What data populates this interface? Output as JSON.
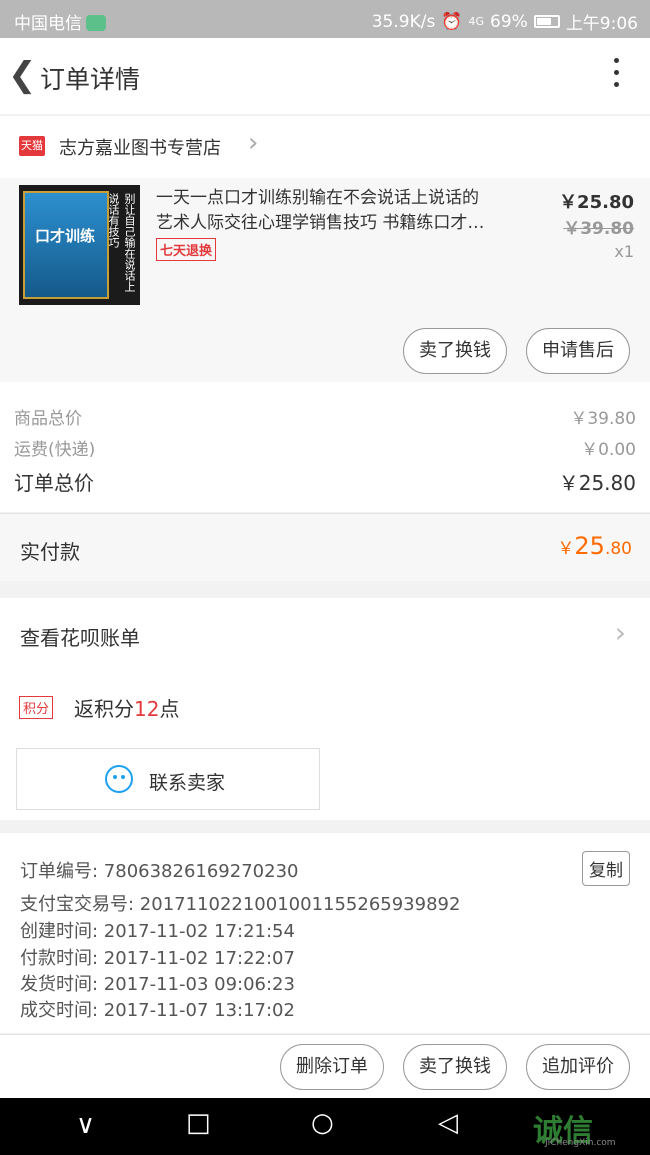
{
  "status_bar": {
    "carrier": "中国电信",
    "speed": "35.9K/s",
    "network": "4G",
    "battery": "69%",
    "time": "上午9:06"
  },
  "header": {
    "title": "订单详情"
  },
  "shop": {
    "badge": "天猫",
    "name": "志方嘉业图书专营店"
  },
  "product": {
    "cover_title": "口才训练",
    "cover_side_text": "别让自己输在说话上 说话有技巧",
    "name_line1": "一天一点口才训练别输在不会说话上说话的",
    "name_line2": "艺术人际交往心理学销售技巧 书籍练口才…",
    "tag": "七天退换",
    "price": "￥25.80",
    "original_price": "￥39.80",
    "quantity": "x1",
    "actions": [
      "卖了换钱",
      "申请售后"
    ]
  },
  "summary": {
    "goods_total_label": "商品总价",
    "goods_total": "￥39.80",
    "shipping_label": "运费(快递)",
    "shipping": "￥0.00",
    "order_total_label": "订单总价",
    "order_total": "￥25.80"
  },
  "payment": {
    "label": "实付款",
    "currency": "￥",
    "integer": "25",
    "decimal": ".80"
  },
  "huabei": {
    "label": "查看花呗账单"
  },
  "points": {
    "badge": "积分",
    "prefix": "返积分",
    "value": "12",
    "suffix": "点"
  },
  "contact": {
    "label": "联系卖家"
  },
  "order_info": {
    "order_no": "订单编号: 78063826169270230",
    "alipay_no": "支付宝交易号: 2017110221001001155265939892",
    "created": "创建时间: 2017-11-02 17:21:54",
    "paid": "付款时间: 2017-11-02 17:22:07",
    "shipped": "发货时间: 2017-11-03 09:06:23",
    "completed": "成交时间: 2017-11-07 13:17:02",
    "copy_label": "复制"
  },
  "bottom_actions": [
    "删除订单",
    "卖了换钱",
    "追加评价"
  ],
  "watermark": {
    "text": "诚信",
    "sub": "JiChengXin.com"
  }
}
